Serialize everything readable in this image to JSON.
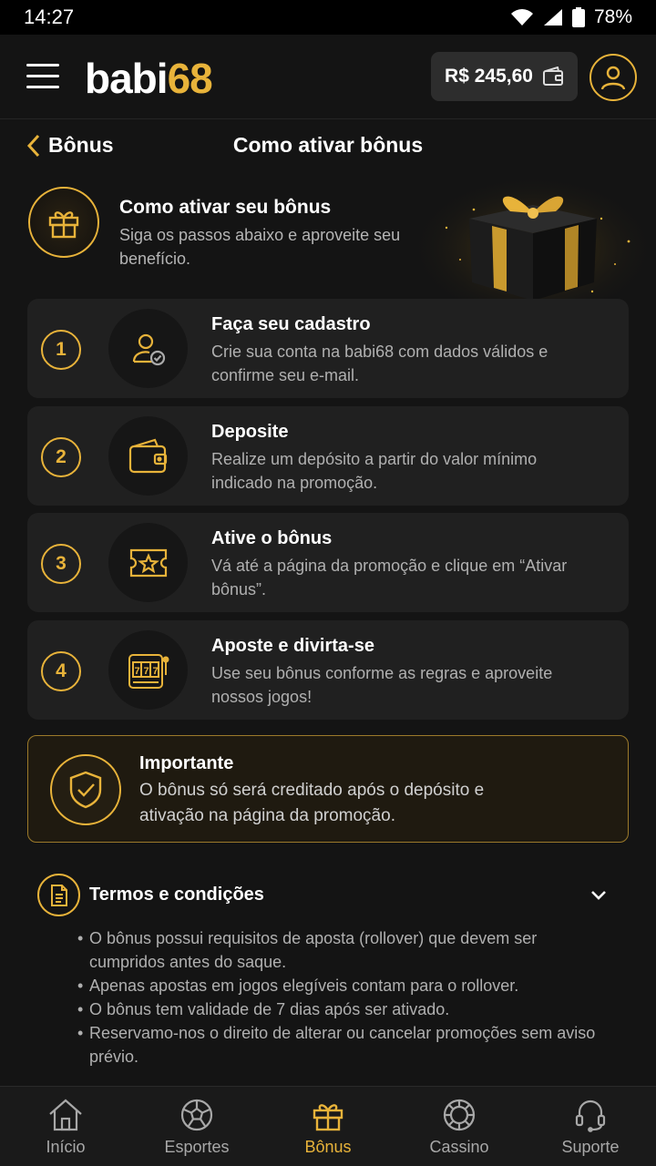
{
  "status": {
    "time": "14:27",
    "battery": "78%"
  },
  "header": {
    "logo_text": "babi",
    "logo_num": "68",
    "balance": "R$ 245,60"
  },
  "nav": {
    "back_label": "Bônus",
    "title": "Como ativar bônus"
  },
  "intro": {
    "title": "Como ativar seu bônus",
    "subtitle": "Siga os passos abaixo e aproveite seu benefício."
  },
  "steps": [
    {
      "number": "1",
      "title": "Faça seu cadastro",
      "desc": "Crie sua conta na babi68 com dados válidos e confirme seu e-mail.",
      "icon": "user-check-icon"
    },
    {
      "number": "2",
      "title": "Deposite",
      "desc": "Realize um depósito a partir do valor mínimo indicado na promoção.",
      "icon": "wallet-icon"
    },
    {
      "number": "3",
      "title": "Ative o bônus",
      "desc": "Vá até a página da promoção e clique em “Ativar bônus”.",
      "icon": "ticket-star-icon"
    },
    {
      "number": "4",
      "title": "Aposte e divirta-se",
      "desc": "Use seu bônus conforme as regras e aproveite nossos jogos!",
      "icon": "slot-machine-icon"
    }
  ],
  "important": {
    "title": "Importante",
    "text": "O bônus só será creditado após o depósito e ativação na página da promoção."
  },
  "terms": {
    "title": "Termos e condições",
    "items": [
      "O bônus possui requisitos de aposta (rollover) que devem ser cumpridos antes do saque.",
      "Apenas apostas em jogos elegíveis contam para o rollover.",
      "O bônus tem validade de 7 dias após ser ativado.",
      "Reservamo-nos o direito de alterar ou cancelar promoções sem aviso prévio."
    ]
  },
  "bottom_nav": [
    {
      "label": "Início",
      "icon": "home-icon"
    },
    {
      "label": "Esportes",
      "icon": "soccer-ball-icon"
    },
    {
      "label": "Bônus",
      "icon": "gift-icon",
      "active": true
    },
    {
      "label": "Cassino",
      "icon": "casino-chip-icon"
    },
    {
      "label": "Suporte",
      "icon": "headset-icon"
    }
  ],
  "colors": {
    "accent": "#e8b33a",
    "background": "#141414",
    "card": "#202020"
  }
}
